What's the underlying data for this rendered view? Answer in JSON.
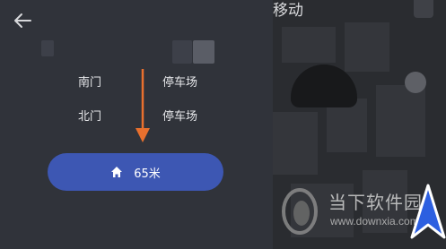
{
  "panel": {
    "route_rows": [
      {
        "location": "南门",
        "type": "停车场"
      },
      {
        "location": "北门",
        "type": "停车场"
      }
    ],
    "navigate_button": {
      "icon": "home-icon",
      "distance": "65米"
    },
    "colors": {
      "panel_bg": "#30333a",
      "button_bg": "#3d57b3",
      "arrow": "#e8702e"
    }
  },
  "map": {
    "title": "移动",
    "watermark": {
      "text": "当下软件园",
      "url": "www.downxia.com"
    }
  }
}
